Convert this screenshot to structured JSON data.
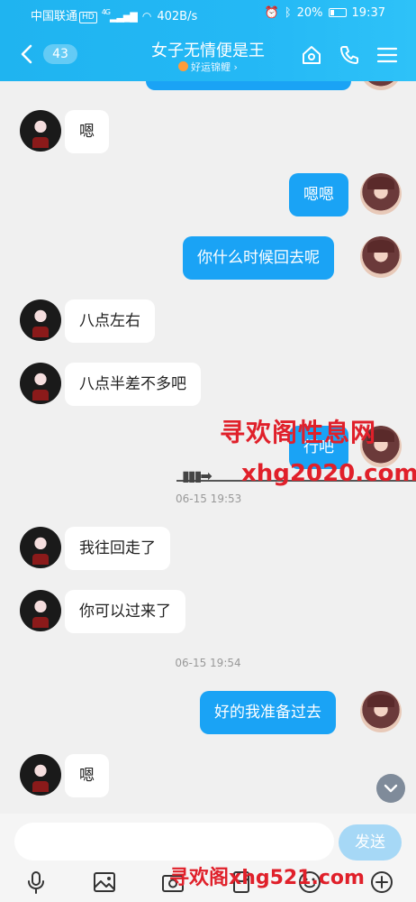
{
  "status_bar": {
    "carrier": "中国联通",
    "hd": "HD",
    "network": "4G",
    "speed": "402B/s",
    "battery": "20%",
    "time": "19:37"
  },
  "header": {
    "unread_count": "43",
    "title": "女子无情便是王",
    "subtitle": "好运锦鲤 ›"
  },
  "messages": [
    {
      "side": "in",
      "text": "嗯"
    },
    {
      "side": "out",
      "text": "嗯嗯"
    },
    {
      "side": "out",
      "text": "你什么时候回去呢"
    },
    {
      "side": "in",
      "text": "八点左右"
    },
    {
      "side": "in",
      "text": "八点半差不多吧"
    },
    {
      "side": "out",
      "text": "行吧"
    },
    {
      "side": "in",
      "text": "我往回走了"
    },
    {
      "side": "in",
      "text": "你可以过来了"
    },
    {
      "side": "out",
      "text": "好的我准备过去"
    },
    {
      "side": "in",
      "text": "嗯"
    }
  ],
  "timestamps": [
    "06-15 19:53",
    "06-15 19:54"
  ],
  "watermarks": {
    "top_cn": "寻欢阁性息网",
    "top_url": "xhg2020.com",
    "bottom": "寻欢阁xhg521.com"
  },
  "input": {
    "placeholder": "",
    "send_label": "发送"
  },
  "colors": {
    "header": "#24b8f5",
    "bubble_out": "#1aa3f5",
    "bubble_in": "#ffffff",
    "send_button": "#a6d8f6",
    "watermark": "#e0202a"
  }
}
